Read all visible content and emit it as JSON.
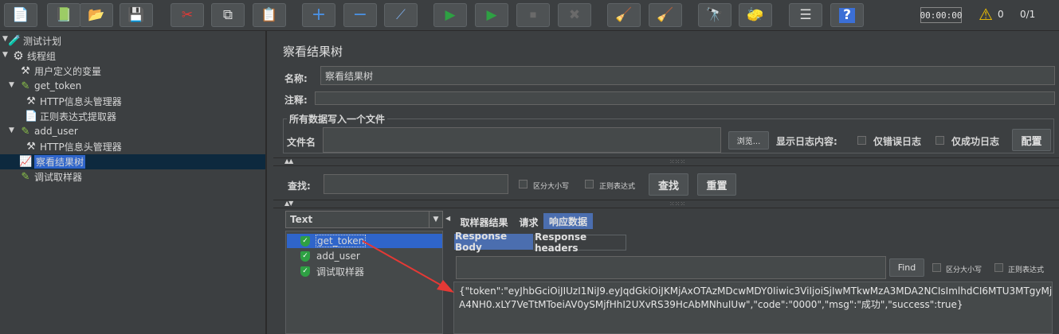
{
  "toolbar": {
    "buttons": [
      {
        "name": "new-icon",
        "glyph": "📄"
      },
      {
        "name": "templates-icon",
        "glyph": "📗"
      },
      {
        "name": "open-icon",
        "glyph": "📂"
      },
      {
        "name": "save-icon",
        "glyph": "💾"
      },
      {
        "name": "cut-icon",
        "glyph": "✂"
      },
      {
        "name": "copy-icon",
        "glyph": "⧉"
      },
      {
        "name": "paste-icon",
        "glyph": "📋"
      },
      {
        "name": "expand-icon",
        "glyph": "+"
      },
      {
        "name": "collapse-icon",
        "glyph": "−"
      },
      {
        "name": "toggle-icon",
        "glyph": "⟋"
      },
      {
        "name": "start-icon",
        "glyph": "▶"
      },
      {
        "name": "start-no-pauses-icon",
        "glyph": "▶"
      },
      {
        "name": "stop-icon",
        "glyph": "⏹"
      },
      {
        "name": "shutdown-icon",
        "glyph": "✖"
      },
      {
        "name": "clear-icon",
        "glyph": "🧹"
      },
      {
        "name": "clear-all-icon",
        "glyph": "🧹"
      },
      {
        "name": "search-icon",
        "glyph": "🔭"
      },
      {
        "name": "reset-search-icon",
        "glyph": "🧽"
      },
      {
        "name": "function-helper-icon",
        "glyph": "☰"
      },
      {
        "name": "help-icon",
        "glyph": "?"
      }
    ],
    "timer": "00:00:00",
    "warning_count": "0",
    "threads": "0/1"
  },
  "tree": {
    "nodes": [
      {
        "label": "测试计划",
        "icon": "🧪"
      },
      {
        "label": "线程组",
        "icon": "⚙"
      },
      {
        "label": "用户定义的变量",
        "icon": "⚒"
      },
      {
        "label": "get_token",
        "icon": "✎"
      },
      {
        "label": "HTTP信息头管理器",
        "icon": "⚒"
      },
      {
        "label": "正则表达式提取器",
        "icon": "📄"
      },
      {
        "label": "add_user",
        "icon": "✎"
      },
      {
        "label": "HTTP信息头管理器",
        "icon": "⚒"
      },
      {
        "label": "察看结果树",
        "icon": "📈"
      },
      {
        "label": "调试取样器",
        "icon": "✎"
      }
    ]
  },
  "panel": {
    "title": "察看结果树",
    "name_label": "名称:",
    "name_value": "察看结果树",
    "comment_label": "注释:",
    "comment_value": "",
    "file_group_title": "所有数据写入一个文件",
    "filename_label": "文件名",
    "filename_value": "",
    "browse_label": "浏览...",
    "log_label": "显示日志内容:",
    "errors_only_label": "仅错误日志",
    "success_only_label": "仅成功日志",
    "configure_label": "配置",
    "search_label": "查找:",
    "search_value": "",
    "case_sensitive_label": "区分大小写",
    "regex_label": "正则表达式",
    "find_label": "查找",
    "reset_label": "重置"
  },
  "results": {
    "renderer": "Text",
    "items": [
      {
        "label": "get_token",
        "status": "success"
      },
      {
        "label": "add_user",
        "status": "success"
      },
      {
        "label": "调试取样器",
        "status": "success"
      }
    ]
  },
  "detail": {
    "tabs": [
      "取样器结果",
      "请求",
      "响应数据"
    ],
    "active_tab": "响应数据",
    "subtabs": [
      "Response Body",
      "Response headers"
    ],
    "active_subtab": "Response Body",
    "find_value": "",
    "find_label": "Find",
    "case_label": "区分大小写",
    "regex_label": "正则表达式",
    "response_body": "{\"token\":\"eyJhbGciOiJIUzI1NiJ9.eyJqdGkiOiJKMjAxOTAzMDcwMDY0Iiwic3ViIjoiSjIwMTkwMzA3MDA2NCIsImlhdCI6MTU3MTgyMjA4NH0.xLY7VeTtMToeiAV0ySMjfHhI2UXvRS39HcAbMNhuIUw\",\"code\":\"0000\",\"msg\":\"成功\",\"success\":true}"
  },
  "colors": {
    "background": "#3c3f41",
    "selection": "#2f65ca",
    "active_tab": "#4b6eaf",
    "success": "#2ea043",
    "annotation_arrow": "#e53935"
  }
}
